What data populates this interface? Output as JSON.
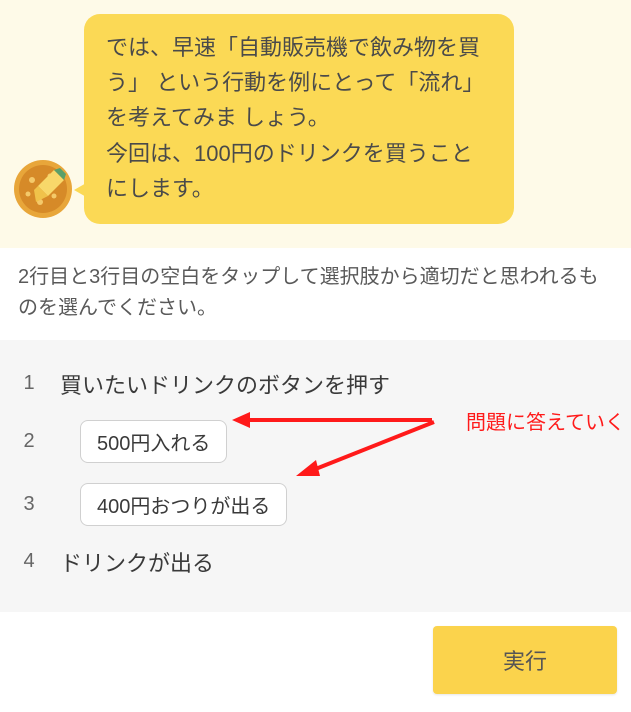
{
  "speech": {
    "line1": "では、早速「自動販売機で飲み物を買う」 という行動を例にとって「流れ」を考えてみま しょう。",
    "line2": "今回は、100円のドリンクを買うことにします。"
  },
  "instruction": "2行目と3行目の空白をタップして選択肢から適切だと思われるものを選んでください。",
  "steps": [
    {
      "num": "1",
      "text": "買いたいドリンクのボタンを押す",
      "type": "text"
    },
    {
      "num": "2",
      "text": "500円入れる",
      "type": "choice"
    },
    {
      "num": "3",
      "text": "400円おつりが出る",
      "type": "choice"
    },
    {
      "num": "4",
      "text": "ドリンクが出る",
      "type": "text"
    }
  ],
  "annotation": "問題に答えていく",
  "exec_label": "実行",
  "colors": {
    "accent": "#fbd955",
    "annotation": "#ff1a1a"
  }
}
